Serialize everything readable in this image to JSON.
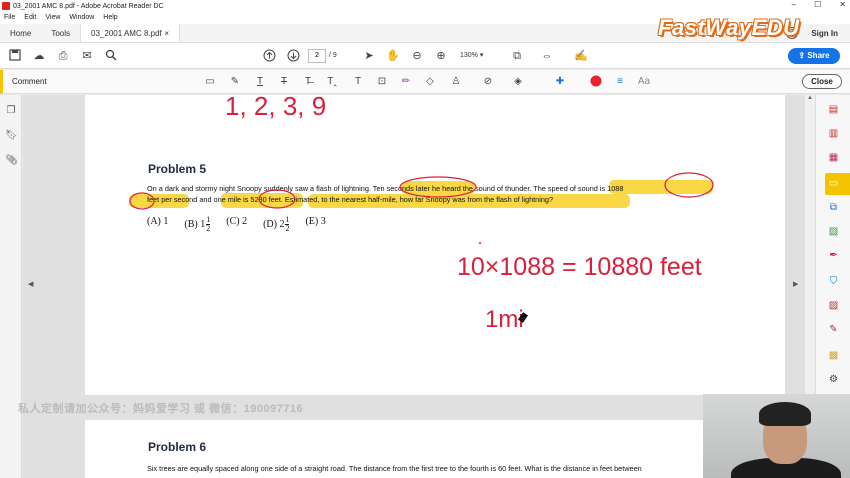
{
  "window": {
    "title": "03_2001 AMC 8.pdf - Adobe Acrobat Reader DC",
    "controls": [
      "–",
      "☐",
      "✕"
    ]
  },
  "menu": [
    "File",
    "Edit",
    "View",
    "Window",
    "Help"
  ],
  "tabs": {
    "home": "Home",
    "tools": "Tools",
    "document": "03_2001 AMC 8.pdf",
    "close": "×",
    "sign_in": "Sign In",
    "help": "?"
  },
  "toolbar": {
    "page_current": "2",
    "page_total": "/ 9",
    "zoom": "130%",
    "share": "Share"
  },
  "comment_bar": {
    "label": "Comment",
    "close": "Close",
    "color_dot": "#e8232b",
    "font_label": "Aa"
  },
  "document": {
    "problem5_title": "Problem 5",
    "problem5_line1": "On a dark and stormy night Snoopy suddenly saw a flash of lightning. Ten seconds later he heard the sound of thunder. The speed of sound is 1088",
    "problem5_line2": "feet per second and one mile is 5280 feet. Estimated, to the nearest half-mile, how far Snoopy was from the flash of lightning?",
    "choice_a": "(A) 1",
    "choice_b_label": "(B) 1",
    "choice_c": "(C) 2",
    "choice_d_label": "(D) 2",
    "choice_e": "(E) 3",
    "fraction_num": "1",
    "fraction_den": "2",
    "handwriting_top": "1, 2, 3, 9",
    "handwriting_equation": "10×1088 = 10880 feet",
    "handwriting_partial": "1mi",
    "problem6_title": "Problem 6",
    "problem6_line1": "Six trees are equally spaced along one side of a straight road. The distance from the first tree to the fourth is 60 feet. What is the distance in feet between"
  },
  "overlay": {
    "watermark_text": "私人定制请加公众号：妈妈爱学习 或 微信：190097716",
    "logo_text": "FastWayEDU"
  },
  "colors": {
    "highlight": "#f8d331",
    "ink": "#d9203b",
    "accent_blue": "#1473e6"
  }
}
